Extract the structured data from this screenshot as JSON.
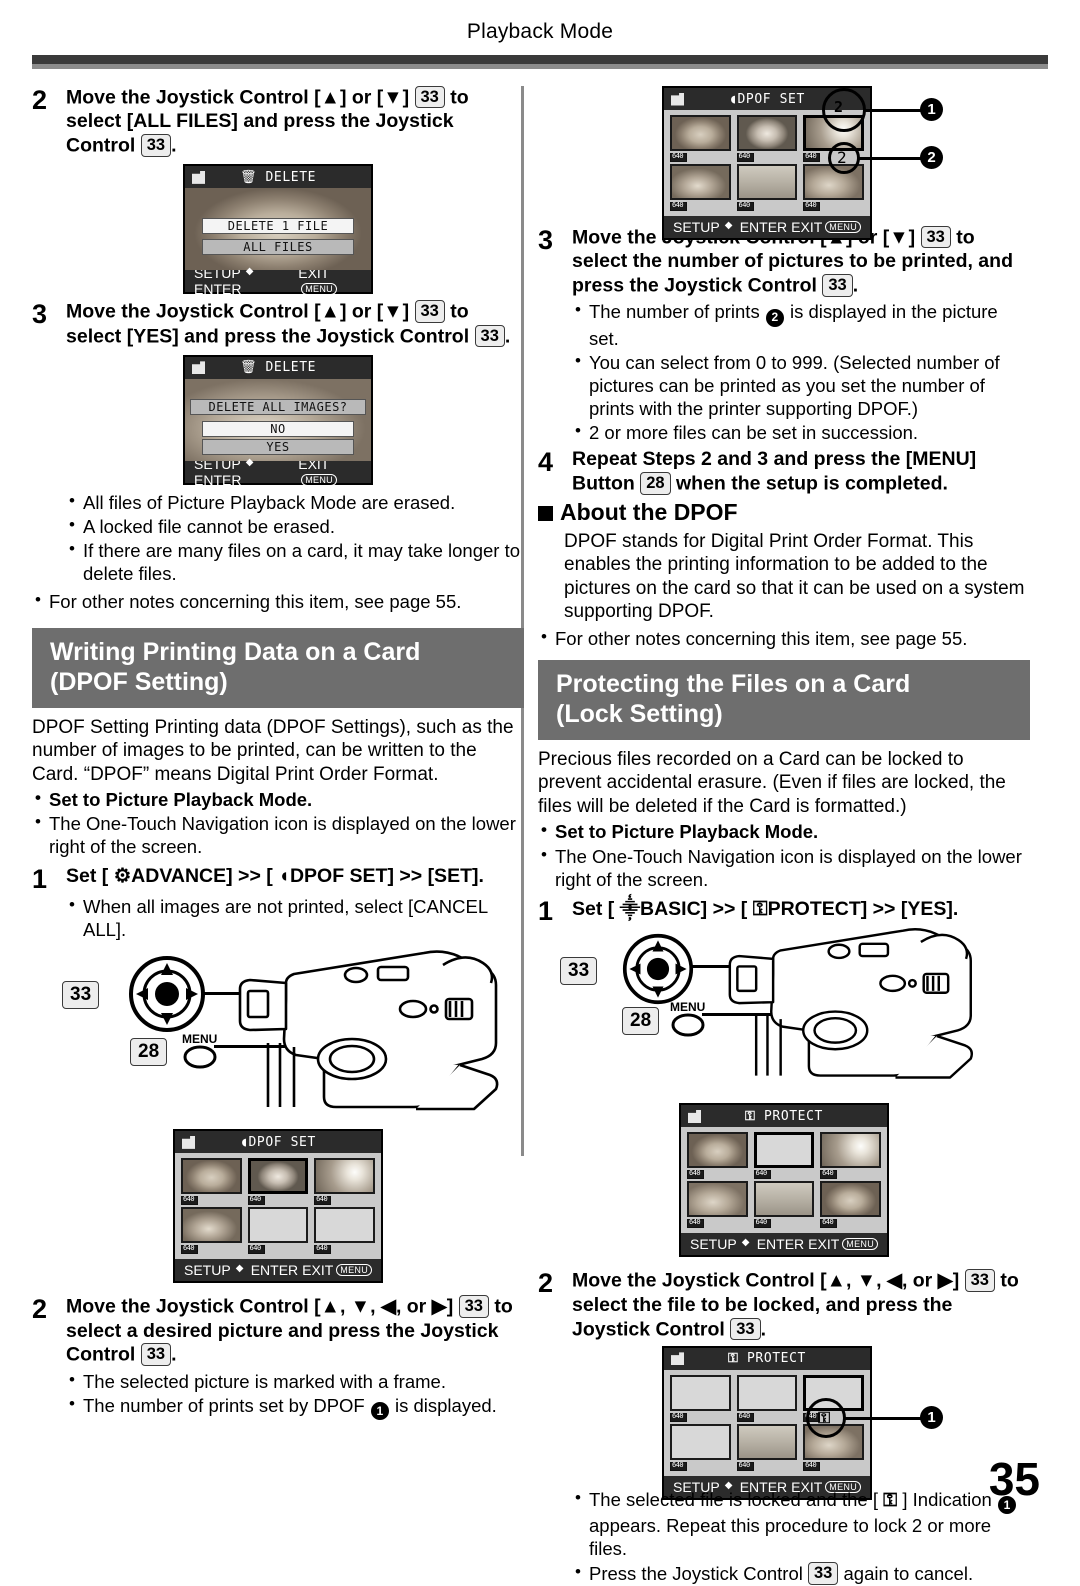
{
  "page": {
    "running_head": "Playback Mode",
    "page_number": "35"
  },
  "refs": {
    "joystick": "33",
    "menu": "28"
  },
  "left_column": {
    "step2": {
      "number": "2",
      "text_a": "Move the Joystick Control [",
      "text_up": "▲",
      "text_b": "] or [",
      "text_down": "▼",
      "text_c": "] ",
      "text_d": " to select [ALL FILES] and press the Joystick Control ",
      "text_e": ".",
      "full": "Move the Joystick Control [▲] or [▼] 33 to select [ALL FILES] and press the Joystick Control 33."
    },
    "screen_delete1": {
      "title": "DELETE",
      "icon": "trash-icon",
      "option_1": "DELETE 1 FILE",
      "option_2": "ALL FILES",
      "footer_left": "SETUP",
      "footer_enter": "ENTER",
      "footer_right": "EXIT",
      "footer_pill": "MENU"
    },
    "step3": {
      "number": "3",
      "full": "Move the Joystick Control [▲] or [▼] 33 to select [YES] and press the Joystick Control 33."
    },
    "screen_delete2": {
      "title": "DELETE",
      "prompt": "DELETE ALL IMAGES?",
      "option_no": "NO",
      "option_yes": "YES",
      "footer_left": "SETUP",
      "footer_enter": "ENTER",
      "footer_right": "EXIT",
      "footer_pill": "MENU"
    },
    "notes_after_step3": [
      "All files of Picture Playback Mode are erased.",
      "A locked file cannot be erased.",
      "If there are many files on a card, it may take longer to delete files."
    ],
    "see_page_note": "For other notes concerning this item, see page 55.",
    "section": {
      "heading_line1": "Writing Printing Data on a Card",
      "heading_line2": "(DPOF Setting)",
      "intro": "DPOF Setting Printing data (DPOF Settings), such as the number of images to be printed, can be written to the Card. “DPOF” means Digital Print Order Format.",
      "bullet_bold": "Set to Picture Playback Mode.",
      "bullet_plain": "The One-Touch Navigation icon is displayed on the lower right of the screen."
    },
    "step1": {
      "number": "1",
      "full": "Set [ ⚙ ADVANCE] >> [ ◗ DPOF SET] >> [SET].",
      "part_set": "Set [",
      "part_advance": "ADVANCE] >> [",
      "part_dpof": "DPOF SET] >> [SET].",
      "note": "When all images are not printed, select [CANCEL ALL]."
    },
    "figure": {
      "joystick_ref": "33",
      "menu_ref": "28",
      "menu_label": "MENU"
    },
    "screen_dpof_set": {
      "title": "DPOF  SET",
      "footer_left": "SETUP",
      "footer_enter": "ENTER",
      "footer_right": "EXIT",
      "footer_pill": "MENU",
      "thumb_badge": "640"
    },
    "step2b": {
      "number": "2",
      "full": "Move the Joystick Control [▲, ▼, ◀, or ▶] 33 to select a desired picture and press the Joystick Control 33.",
      "notes": [
        "The selected picture is marked with a frame.",
        "The number of prints set by DPOF ❶ is displayed."
      ]
    }
  },
  "right_column": {
    "screen_dpof_set_top": {
      "title": "DPOF  SET",
      "footer_left": "SETUP",
      "footer_enter": "ENTER",
      "footer_right": "EXIT",
      "footer_pill": "MENU",
      "callout_1": "1",
      "callout_2": "2",
      "print_count_badge": "2",
      "print_count_circle": "2",
      "thumb_badge": "640"
    },
    "step3": {
      "number": "3",
      "full": "Move the Joystick Control [▲] or [▼] 33 to select the number of pictures to be printed, and press the Joystick Control 33.",
      "notes": [
        "The number of prints ❷ is displayed in the picture set.",
        "You can select from 0 to 999. (Selected number of pictures can be printed as you set the number of prints with the printer supporting DPOF.)",
        "2 or more files can be set in succession."
      ]
    },
    "step4": {
      "number": "4",
      "full": "Repeat Steps 2 and 3 and press the [MENU] Button 28 when the setup is completed."
    },
    "about": {
      "heading": "About the DPOF",
      "body": "DPOF stands for Digital Print Order Format. This enables the printing information to be added to the pictures on the card so that it can be used on a system supporting DPOF.",
      "see_page_note": "For other notes concerning this item, see page 55."
    },
    "section": {
      "heading_line1": "Protecting the Files on a Card",
      "heading_line2": "(Lock Setting)",
      "intro": "Precious files recorded on a Card can be locked to prevent accidental erasure. (Even if files are locked, the files will be deleted if the Card is formatted.)",
      "bullet_bold": "Set to Picture Playback Mode.",
      "bullet_plain": "The One-Touch Navigation icon is displayed on the lower right of the screen."
    },
    "step1": {
      "number": "1",
      "full": "Set [ ⸎ BASIC] >> [ ⚿ PROTECT] >> [YES].",
      "part_set": "Set [",
      "part_basic": "BASIC] >> [",
      "part_protect": "PROTECT] >> [YES]."
    },
    "figure": {
      "joystick_ref": "33",
      "menu_ref": "28",
      "menu_label": "MENU"
    },
    "screen_protect_1": {
      "title": "PROTECT",
      "footer_left": "SETUP",
      "footer_enter": "ENTER",
      "footer_right": "EXIT",
      "footer_pill": "MENU",
      "thumb_badge": "640"
    },
    "step2": {
      "number": "2",
      "full": "Move the Joystick Control [▲, ▼, ◀, or ▶] 33 to select the file to be locked, and press the Joystick Control 33."
    },
    "screen_protect_2": {
      "title": "PROTECT",
      "footer_left": "SETUP",
      "footer_enter": "ENTER",
      "footer_right": "EXIT",
      "footer_pill": "MENU",
      "callout_1": "1",
      "thumb_badge": "640"
    },
    "final_notes": [
      "The selected file is locked and the [ ⚿ ] Indication ❶ appears. Repeat this procedure to lock 2 or more files.",
      "Press the Joystick Control 33 again to cancel."
    ]
  }
}
